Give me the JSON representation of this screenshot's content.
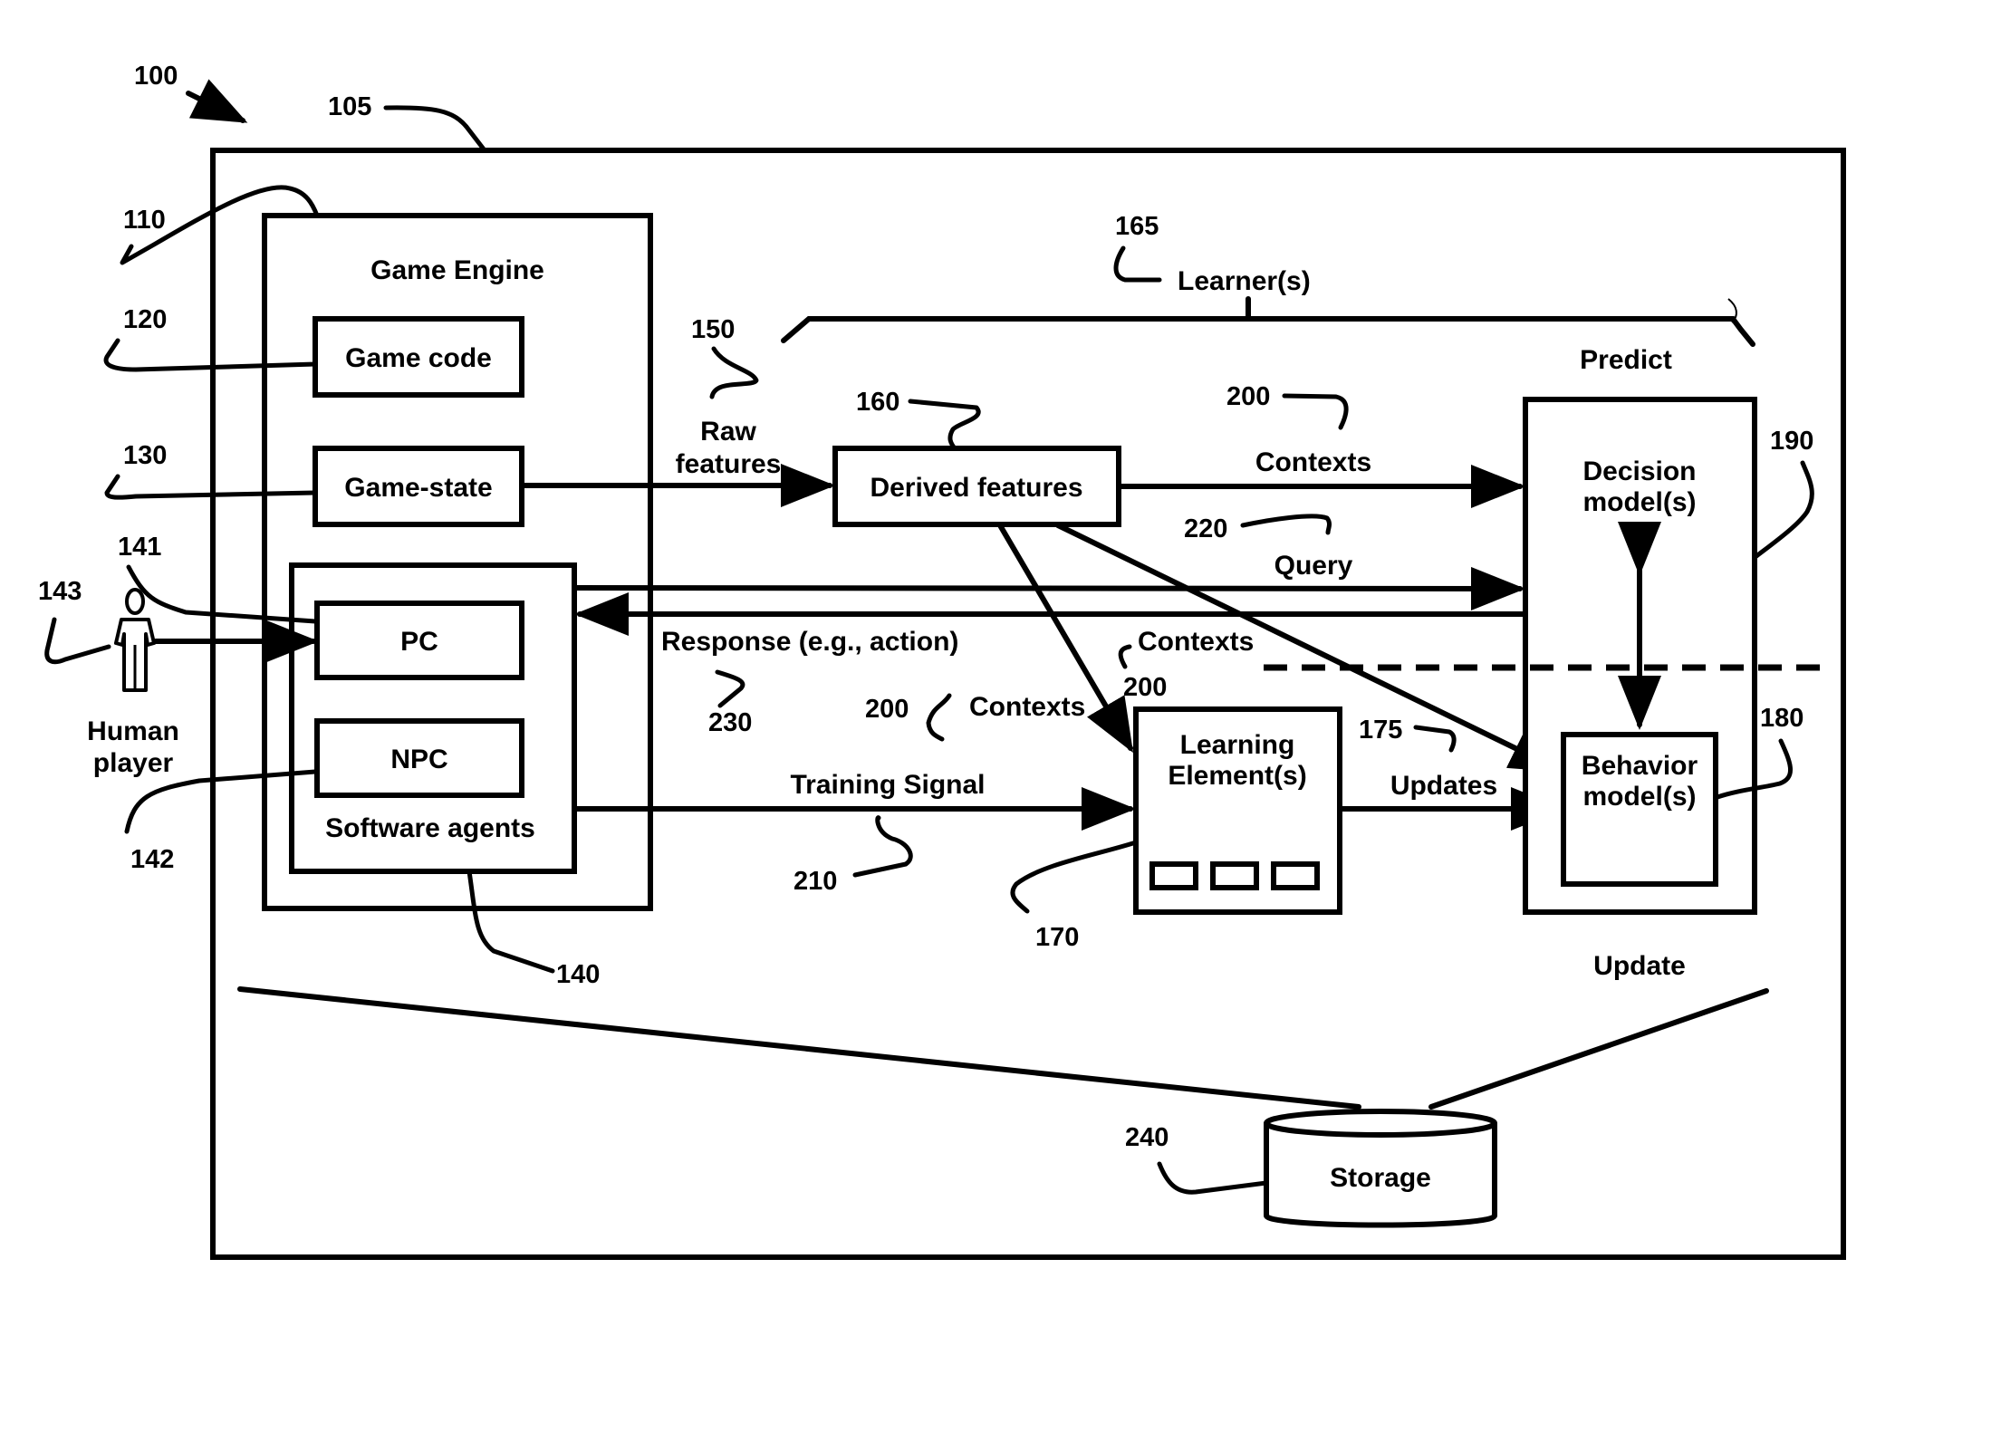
{
  "figure": {
    "ref_system": "100",
    "ref_environment": "105"
  },
  "game_engine": {
    "ref": "110",
    "title": "Game Engine",
    "game_code": {
      "ref": "120",
      "label": "Game code"
    },
    "game_state": {
      "ref": "130",
      "label": "Game-state"
    },
    "software_agents": {
      "ref": "140",
      "label": "Software agents",
      "pc": {
        "ref": "141",
        "label": "PC"
      },
      "npc": {
        "ref": "142",
        "label": "NPC"
      }
    }
  },
  "human_player": {
    "ref": "143",
    "line1": "Human",
    "line2": "player"
  },
  "raw_features": {
    "ref": "150",
    "line1": "Raw",
    "line2": "features"
  },
  "derived_features": {
    "ref": "160",
    "label": "Derived features"
  },
  "learners": {
    "ref": "165",
    "label": "Learner(s)"
  },
  "learning_element": {
    "ref": "170",
    "line1": "Learning",
    "line2": "Element(s)"
  },
  "updates": {
    "ref": "175",
    "label": "Updates"
  },
  "behavior_model": {
    "ref": "180",
    "line1": "Behavior",
    "line2": "model(s)"
  },
  "decision_model": {
    "ref": "190",
    "line1": "Decision",
    "line2": "model(s)"
  },
  "predict_label": "Predict",
  "update_label": "Update",
  "contexts": {
    "ref": "200",
    "label": "Contexts"
  },
  "training_signal": {
    "ref": "210",
    "label": "Training Signal"
  },
  "query": {
    "ref": "220",
    "label": "Query"
  },
  "response": {
    "ref": "230",
    "label": "Response (e.g., action)"
  },
  "storage": {
    "ref": "240",
    "label": "Storage"
  }
}
